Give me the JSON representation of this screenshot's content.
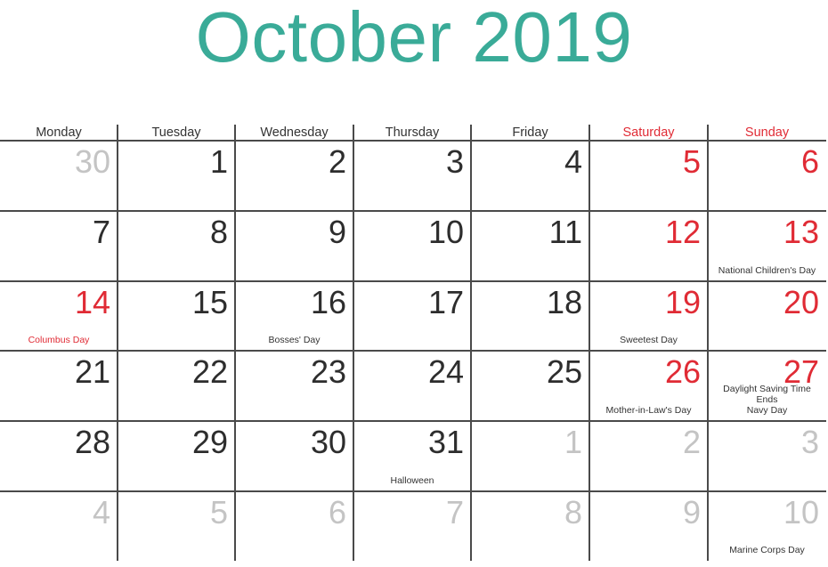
{
  "calendar": {
    "title": "October 2019",
    "colors": {
      "title": "#3aab98",
      "weekend": "#e02b35",
      "text": "#2d2d2d",
      "muted": "#c4c4c4",
      "grid": "#4a4a4a"
    },
    "weekdays": [
      {
        "label": "Monday",
        "weekend": false
      },
      {
        "label": "Tuesday",
        "weekend": false
      },
      {
        "label": "Wednesday",
        "weekend": false
      },
      {
        "label": "Thursday",
        "weekend": false
      },
      {
        "label": "Friday",
        "weekend": false
      },
      {
        "label": "Saturday",
        "weekend": true
      },
      {
        "label": "Sunday",
        "weekend": true
      }
    ],
    "weeks": [
      [
        {
          "day": "30",
          "muted": true
        },
        {
          "day": "1"
        },
        {
          "day": "2"
        },
        {
          "day": "3"
        },
        {
          "day": "4"
        },
        {
          "day": "5",
          "weekend": true
        },
        {
          "day": "6",
          "weekend": true
        }
      ],
      [
        {
          "day": "7"
        },
        {
          "day": "8"
        },
        {
          "day": "9"
        },
        {
          "day": "10"
        },
        {
          "day": "11"
        },
        {
          "day": "12",
          "weekend": true
        },
        {
          "day": "13",
          "weekend": true,
          "event": "National Children's Day"
        }
      ],
      [
        {
          "day": "14",
          "weekend": true,
          "event": "Columbus Day",
          "holiday": true
        },
        {
          "day": "15"
        },
        {
          "day": "16",
          "event": "Bosses' Day"
        },
        {
          "day": "17"
        },
        {
          "day": "18"
        },
        {
          "day": "19",
          "weekend": true,
          "event": "Sweetest Day"
        },
        {
          "day": "20",
          "weekend": true
        }
      ],
      [
        {
          "day": "21"
        },
        {
          "day": "22"
        },
        {
          "day": "23"
        },
        {
          "day": "24"
        },
        {
          "day": "25"
        },
        {
          "day": "26",
          "weekend": true,
          "event": "Mother-in-Law's Day"
        },
        {
          "day": "27",
          "weekend": true,
          "event": "Daylight Saving Time Ends\nNavy Day"
        }
      ],
      [
        {
          "day": "28"
        },
        {
          "day": "29"
        },
        {
          "day": "30"
        },
        {
          "day": "31",
          "event": "Halloween"
        },
        {
          "day": "1",
          "muted": true
        },
        {
          "day": "2",
          "muted": true
        },
        {
          "day": "3",
          "muted": true
        }
      ],
      [
        {
          "day": "4",
          "muted": true
        },
        {
          "day": "5",
          "muted": true
        },
        {
          "day": "6",
          "muted": true
        },
        {
          "day": "7",
          "muted": true
        },
        {
          "day": "8",
          "muted": true
        },
        {
          "day": "9",
          "muted": true
        },
        {
          "day": "10",
          "muted": true,
          "event": "Marine Corps Day"
        }
      ]
    ]
  }
}
